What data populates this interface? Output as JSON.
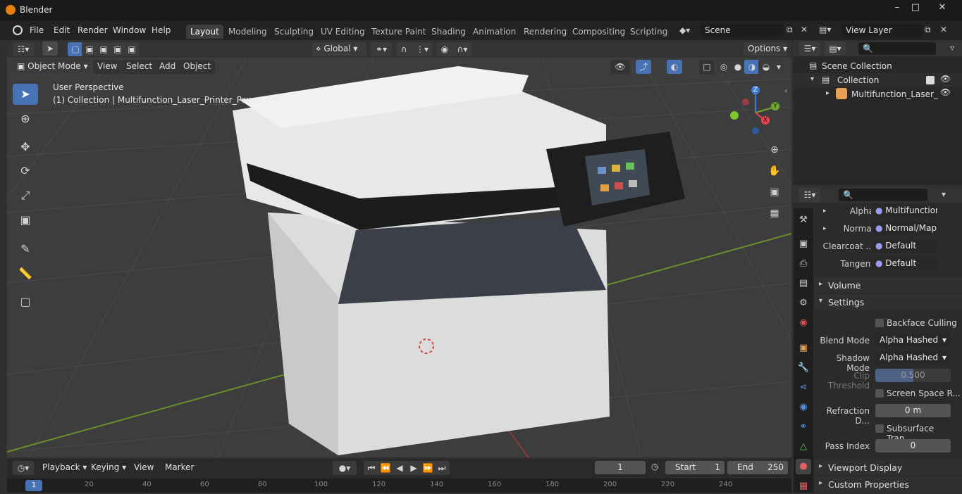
{
  "window": {
    "title": "Blender"
  },
  "menu": [
    "File",
    "Edit",
    "Render",
    "Window",
    "Help"
  ],
  "workspaces": [
    "Layout",
    "Modeling",
    "Sculpting",
    "UV Editing",
    "Texture Paint",
    "Shading",
    "Animation",
    "Rendering",
    "Compositing",
    "Scripting"
  ],
  "scene": {
    "name": "Scene",
    "view_layer": "View Layer"
  },
  "header": {
    "transform_orientation": "Global",
    "options": "Options"
  },
  "viewport_header": {
    "mode": "Object Mode",
    "menus": [
      "View",
      "Select",
      "Add",
      "Object"
    ]
  },
  "viewport": {
    "perspective": "User Perspective",
    "collection_info": "(1) Collection | Multifunction_Laser_Printer_Power_ON",
    "gizmo": {
      "z": "Z",
      "y": "Y",
      "x": "X"
    }
  },
  "outliner": {
    "root": "Scene Collection",
    "collection": "Collection",
    "object": "Multifunction_Laser_"
  },
  "properties": {
    "inputs": [
      {
        "label": "Alpha",
        "value": "Multifunction..."
      },
      {
        "label": "Normal",
        "value": "Normal/Map"
      },
      {
        "label": "Clearcoat ...",
        "value": "Default"
      },
      {
        "label": "Tangent",
        "value": "Default"
      }
    ],
    "volume": "Volume",
    "settings": "Settings",
    "backface_culling": "Backface Culling",
    "blend_mode_label": "Blend Mode",
    "blend_mode": "Alpha Hashed",
    "shadow_mode_label": "Shadow Mode",
    "shadow_mode": "Alpha Hashed",
    "clip_threshold_label": "Clip Threshold",
    "clip_threshold": "0.500",
    "screen_space": "Screen Space R...",
    "refraction_label": "Refraction D...",
    "refraction": "0 m",
    "subsurface": "Subsurface Tran...",
    "pass_index_label": "Pass Index",
    "pass_index": "0",
    "viewport_display": "Viewport Display",
    "custom_properties": "Custom Properties"
  },
  "timeline": {
    "menus": [
      "Playback",
      "Keying",
      "View",
      "Marker"
    ],
    "current_frame": "1",
    "start_label": "Start",
    "start": "1",
    "end_label": "End",
    "end": "250",
    "ticks": [
      "1",
      "20",
      "40",
      "60",
      "80",
      "100",
      "120",
      "140",
      "160",
      "180",
      "200",
      "220",
      "240"
    ]
  },
  "colors": {
    "accent": "#4772b3",
    "x_axis": "#e8434f",
    "y_axis": "#6ba82b",
    "z_axis": "#3d7bd9"
  }
}
